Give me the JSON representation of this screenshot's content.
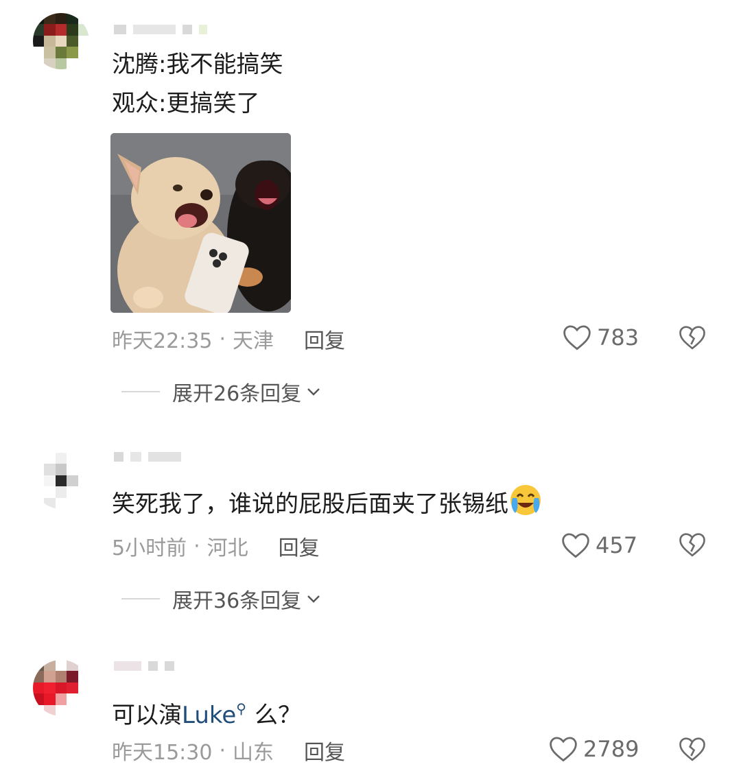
{
  "comments": [
    {
      "lines": [
        "沈腾:我不能搞笑",
        "观众:更搞笑了"
      ],
      "time": "昨天22:35",
      "location": "天津",
      "reply_label": "回复",
      "likes": "783",
      "expand_label": "展开26条回复",
      "avatar_colors": [
        "#0f1a0f",
        "#3a2a1a",
        "#2b1e12",
        "#1a2a1a",
        "#ffffff",
        "#2a3a2a",
        "#8b1c1c",
        "#b52a2a",
        "#2a3a1a",
        "#d9e6d0",
        "#1a1a1a",
        "#c8b89a",
        "#e8d8c0",
        "#4a5a2a",
        "#ffffff",
        "#ffffff",
        "#c8c0a0",
        "#6a7a3a",
        "#8a9a4a",
        "#ffffff",
        "#ffffff",
        "#d8d0c0",
        "#b8c8a0",
        "#ffffff",
        "#ffffff"
      ]
    },
    {
      "text": "笑死我了，谁说的屁股后面夹了张锡纸",
      "time": "5小时前",
      "location": "河北",
      "reply_label": "回复",
      "likes": "457",
      "expand_label": "展开36条回复",
      "avatar_colors": [
        "#ffffff",
        "#ffffff",
        "#f0f0f0",
        "#ffffff",
        "#ffffff",
        "#ffffff",
        "#e0e0e0",
        "#c8c8c8",
        "#ffffff",
        "#ffffff",
        "#ffffff",
        "#f5f5f5",
        "#2a2a2a",
        "#d0d0d0",
        "#ffffff",
        "#ffffff",
        "#ffffff",
        "#ececec",
        "#ffffff",
        "#ffffff",
        "#ffffff",
        "#e8e8e8",
        "#ffffff",
        "#ffffff",
        "#ffffff"
      ]
    },
    {
      "text": "可以演",
      "link_text": "Luke",
      "text_after": "么？",
      "time": "昨天15:30",
      "location": "山东",
      "reply_label": "回复",
      "likes": "2789",
      "avatar_colors": [
        "#6a5a4a",
        "#c8b0a0",
        "#ffffff",
        "#e0d0d0",
        "#ffffff",
        "#8a6a5a",
        "#d0a090",
        "#b08070",
        "#7a1a2a",
        "#ffffff",
        "#e81a2a",
        "#f02030",
        "#d81828",
        "#e02030",
        "#ffffff",
        "#c81020",
        "#e81828",
        "#f0a0a0",
        "#ffffff",
        "#ffffff",
        "#ffffff",
        "#f0d0d0",
        "#ffffff",
        "#ffffff",
        "#ffffff"
      ]
    }
  ],
  "separator": "·",
  "icons": {
    "like": "heart-outline-icon",
    "dislike": "broken-heart-icon",
    "expand": "chevron-down-icon",
    "search": "search-icon",
    "emoji": "crying-laughing-emoji"
  }
}
